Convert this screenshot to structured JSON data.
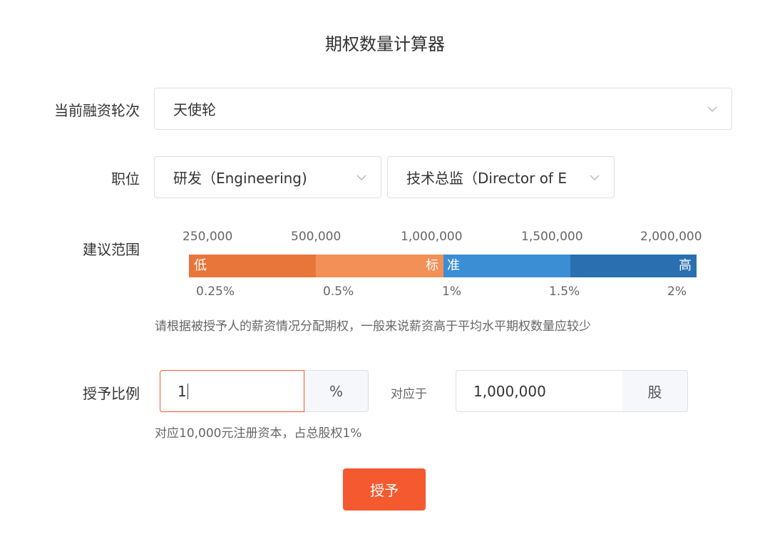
{
  "page": {
    "title": "期权数量计算器"
  },
  "round": {
    "label": "当前融资轮次",
    "value": "天使轮"
  },
  "position": {
    "label": "职位",
    "department": "研发（Engineering)",
    "role": "技术总监（Director of E"
  },
  "range": {
    "label": "建议范围",
    "shares_ticks": [
      "250,000",
      "500,000",
      "1,000,000",
      "1,500,000",
      "2,000,000"
    ],
    "percent_ticks": [
      "0.25%",
      "0.5%",
      "1%",
      "1.5%",
      "2%"
    ],
    "bar": {
      "low": "低",
      "standard_left": "标",
      "standard_right": "准",
      "high": "高"
    },
    "hint": "请根据被授予人的薪资情况分配期权，一般来说薪资高于平均水平期权数量应较少"
  },
  "grant": {
    "label": "授予比例",
    "ratio_value": "1",
    "ratio_unit": "%",
    "corresponds_label": "对应于",
    "shares_value": "1,000,000",
    "shares_unit": "股",
    "note": "对应10,000元注册资本，占总股权1%",
    "button_label": "授予"
  },
  "colors": {
    "accent": "#f4592f",
    "seg_low": "#e8763a",
    "seg_standard_low": "#f29058",
    "seg_standard_high": "#3b8ed4",
    "seg_high": "#2a6fb0"
  }
}
